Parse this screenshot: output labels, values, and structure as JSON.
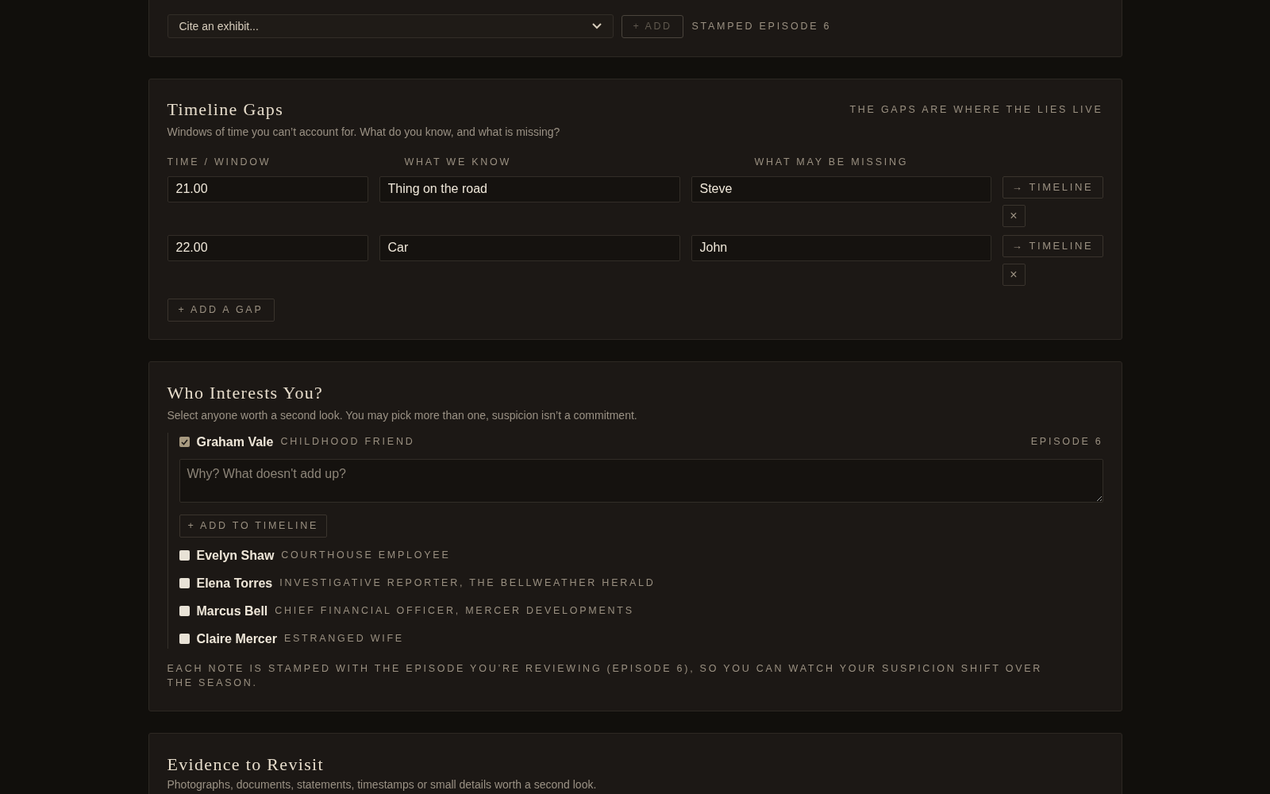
{
  "exhibit_card": {
    "select": {
      "value": "Cite an exhibit..."
    },
    "add_button": {
      "label": "+ ADD",
      "disabled": true
    },
    "stamp": "STAMPED EPISODE 6"
  },
  "timeline_gaps": {
    "title": "Timeline Gaps",
    "tagline": "THE GAPS ARE WHERE THE LIES LIVE",
    "subtitle": "Windows of time you can’t account for. What do you know, and what is missing?",
    "columns": [
      "TIME / WINDOW",
      "WHAT WE KNOW",
      "WHAT MAY BE MISSING"
    ],
    "rows": [
      {
        "time": "21.00",
        "known": "Thing on the road",
        "missing": "Steve",
        "timeline_button": "→ TIMELINE",
        "remove_button": "×"
      },
      {
        "time": "22.00",
        "known": "Car",
        "missing": "John",
        "timeline_button": "→ TIMELINE",
        "remove_button": "×"
      }
    ],
    "add_button": "+ ADD A GAP"
  },
  "who_interests": {
    "title": "Who Interests You?",
    "subtitle": "Select anyone worth a second look. You may pick more than one, suspicion isn’t a commitment.",
    "people": [
      {
        "name": "Graham Vale",
        "role": "CHILDHOOD FRIEND",
        "checked": true,
        "episode": "EPISODE 6",
        "note": {
          "placeholder": "Why? What doesn't add up?"
        },
        "timeline_button": "+ ADD TO TIMELINE"
      },
      {
        "name": "Evelyn Shaw",
        "role": "COURTHOUSE EMPLOYEE",
        "checked": false
      },
      {
        "name": "Elena Torres",
        "role": "INVESTIGATIVE REPORTER, THE BELLWEATHER HERALD",
        "checked": false
      },
      {
        "name": "Marcus Bell",
        "role": "CHIEF FINANCIAL OFFICER, MERCER DEVELOPMENTS",
        "checked": false
      },
      {
        "name": "Claire Mercer",
        "role": "ESTRANGED WIFE",
        "checked": false
      }
    ],
    "footnote": "EACH NOTE IS STAMPED WITH THE EPISODE YOU’RE REVIEWING (EPISODE 6), SO YOU CAN WATCH YOUR SUSPICION SHIFT OVER THE SEASON."
  },
  "evidence": {
    "title": "Evidence to Revisit",
    "subtitle": "Photographs, documents, statements, timestamps or small details worth a second look."
  }
}
